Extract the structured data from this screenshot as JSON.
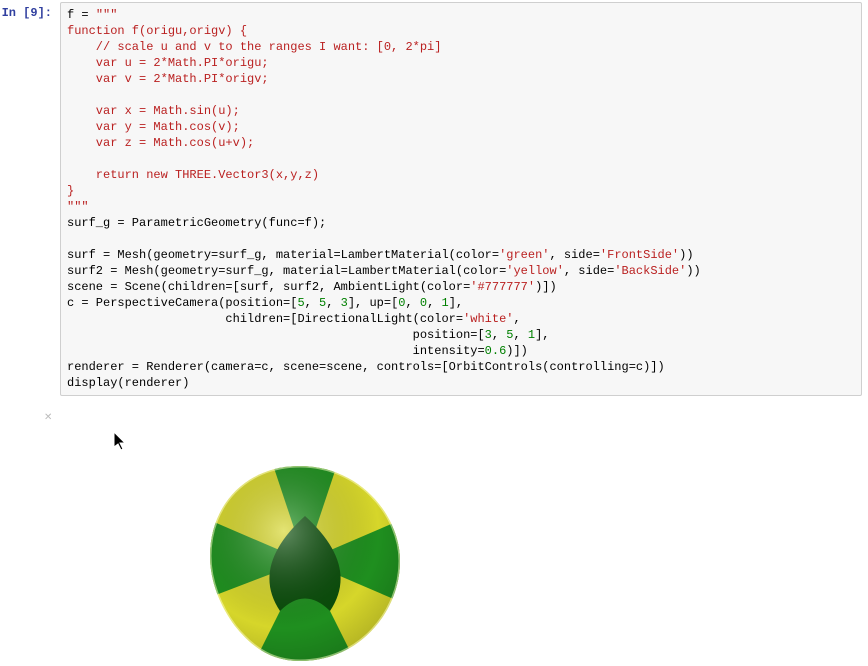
{
  "cell": {
    "prompt_label": "In [9]:",
    "code": {
      "l01a": "f = ",
      "l01b": "\"\"\"",
      "l02": "function f(origu,origv) {",
      "l03": "    // scale u and v to the ranges I want: [0, 2*pi]",
      "l04": "    var u = 2*Math.PI*origu;",
      "l05": "    var v = 2*Math.PI*origv;",
      "blank1": "",
      "l06": "    var x = Math.sin(u);",
      "l07": "    var y = Math.cos(v);",
      "l08": "    var z = Math.cos(u+v);",
      "blank2": "",
      "l09": "    return new THREE.Vector3(x,y,z)",
      "l10": "}",
      "l11": "\"\"\"",
      "l12a": "surf_g = ParametricGeometry(func=f);",
      "blank3": "",
      "l13a": "surf = Mesh(geometry=surf_g, material=LambertMaterial(color=",
      "l13b": "'green'",
      "l13c": ", side=",
      "l13d": "'FrontSide'",
      "l13e": "))",
      "l14a": "surf2 = Mesh(geometry=surf_g, material=LambertMaterial(color=",
      "l14b": "'yellow'",
      "l14c": ", side=",
      "l14d": "'BackSide'",
      "l14e": "))",
      "l15a": "scene = Scene(children=[surf, surf2, AmbientLight(color=",
      "l15b": "'#777777'",
      "l15c": ")])",
      "l16a": "c = PerspectiveCamera(position=[",
      "l16b": "5",
      "l16c": ", ",
      "l16d": "5",
      "l16e": ", ",
      "l16f": "3",
      "l16g": "], up=[",
      "l16h": "0",
      "l16i": ", ",
      "l16j": "0",
      "l16k": ", ",
      "l16l": "1",
      "l16m": "],",
      "l17a": "                      children=[DirectionalLight(color=",
      "l17b": "'white'",
      "l17c": ",",
      "l18a": "                                                position=[",
      "l18b": "3",
      "l18c": ", ",
      "l18d": "5",
      "l18e": ", ",
      "l18f": "1",
      "l18g": "],",
      "l19a": "                                                intensity=",
      "l19b": "0.6",
      "l19c": ")])",
      "l20": "renderer = Renderer(camera=c, scene=scene, controls=[OrbitControls(controlling=c)])",
      "l21": "display(renderer)"
    }
  },
  "output": {
    "close_glyph": "✕"
  },
  "colors": {
    "front": "green",
    "back": "yellow"
  }
}
